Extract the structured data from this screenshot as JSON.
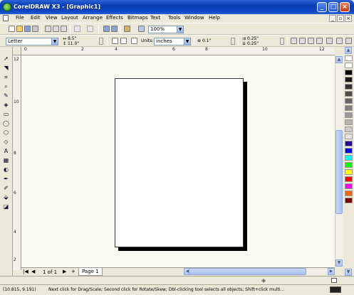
{
  "window": {
    "title": "CorelDRAW X3 - [Graphic1]"
  },
  "menu": {
    "items": [
      "File",
      "Edit",
      "View",
      "Layout",
      "Arrange",
      "Effects",
      "Bitmaps",
      "Text",
      "Tools",
      "Window",
      "Help"
    ]
  },
  "standard_toolbar": {
    "zoom_level": "100%"
  },
  "property_bar": {
    "paper_size": "Letter",
    "width": "8.5\"",
    "height": "11.0\"",
    "units_label": "Units:",
    "units_value": "inches",
    "nudge": "0.1\"",
    "duplicate_x": "0.25\"",
    "duplicate_y": "0.25\""
  },
  "rulers": {
    "horizontal_ticks": [
      "0",
      "2",
      "4",
      "6",
      "8",
      "10",
      "12"
    ],
    "vertical_ticks": [
      "12",
      "10",
      "8",
      "6",
      "4",
      "2"
    ]
  },
  "page_nav": {
    "counter": "1 of 1",
    "page_tab": "Page 1"
  },
  "status": {
    "coordinates": "(10.815, 9.191)",
    "message": "Next click for Drag/Scale; Second click for Rotate/Skew; Dbl-clicking tool selects all objects; Shift+click multi..."
  },
  "palette": {
    "colors": [
      "#FFFFFF",
      "#000000",
      "#1A1A1A",
      "#333333",
      "#4D4D4D",
      "#666666",
      "#808080",
      "#999999",
      "#B3B3B3",
      "#CCCCCC",
      "#E6E6E6",
      "#2A00A0",
      "#0000FF",
      "#00FFFF",
      "#00FF00",
      "#FFFF00",
      "#FF0000",
      "#FF00FF",
      "#FF6600",
      "#800000"
    ]
  },
  "colors": {
    "title_bar": "#0A3DB4",
    "chrome": "#ECE9D8",
    "canvas": "#FBFBF2"
  }
}
